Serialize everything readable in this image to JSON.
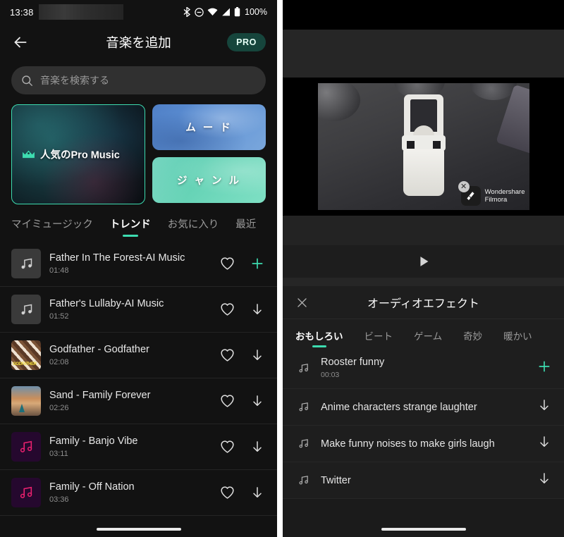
{
  "left": {
    "statusbar": {
      "time": "13:38",
      "battery_pct": "100%",
      "icons": [
        "bluetooth-icon",
        "do-not-disturb-icon",
        "wifi-icon",
        "cellular-signal-icon",
        "battery-icon"
      ]
    },
    "header": {
      "title": "音楽を追加",
      "pro_label": "PRO",
      "back_icon": "back-arrow-icon"
    },
    "search": {
      "placeholder": "音楽を検索する",
      "icon": "search-icon"
    },
    "cards": {
      "featured": {
        "label": "人気のPro Music",
        "icon": "crown-icon",
        "accent": "#3ddcb0"
      },
      "mood": {
        "label": "ム ー ド",
        "accent": "#5d90d4"
      },
      "genre": {
        "label": "ジ ャ ン ル",
        "accent": "#66d3b6"
      }
    },
    "tabs": [
      {
        "label": "マイミュージック",
        "active": false
      },
      {
        "label": "トレンド",
        "active": true
      },
      {
        "label": "お気に入り",
        "active": false
      },
      {
        "label": "最近",
        "active": false
      }
    ],
    "songs": [
      {
        "title": "Father In The Forest-AI Music",
        "duration": "01:48",
        "thumb": "note-gray",
        "action": "add",
        "fav_icon": "heart-icon"
      },
      {
        "title": "Father's Lullaby-AI Music",
        "duration": "01:52",
        "thumb": "note-gray",
        "action": "download",
        "fav_icon": "heart-icon"
      },
      {
        "title": "Godfather - Godfather",
        "duration": "02:08",
        "thumb": "stripes",
        "action": "download",
        "fav_icon": "heart-icon"
      },
      {
        "title": "Sand - Family Forever",
        "duration": "02:26",
        "thumb": "sand",
        "action": "download",
        "fav_icon": "heart-icon"
      },
      {
        "title": "Family - Banjo Vibe",
        "duration": "03:11",
        "thumb": "purple-note",
        "action": "download",
        "fav_icon": "heart-icon"
      },
      {
        "title": "Family - Off Nation",
        "duration": "03:36",
        "thumb": "purple-note",
        "action": "download",
        "fav_icon": "heart-icon"
      }
    ]
  },
  "right": {
    "watermark": {
      "brand": "Wondershare",
      "product": "Filmora",
      "close_icon": "close-icon"
    },
    "play_icon": "play-icon",
    "sheet": {
      "title": "オーディオエフェクト",
      "close_icon": "close-icon",
      "tabs": [
        {
          "label": "おもしろい",
          "active": true
        },
        {
          "label": "ビート",
          "active": false
        },
        {
          "label": "ゲーム",
          "active": false
        },
        {
          "label": "奇妙",
          "active": false
        },
        {
          "label": "暖かい",
          "active": false
        }
      ],
      "effects": [
        {
          "title": "Rooster funny",
          "duration": "00:03",
          "action": "add"
        },
        {
          "title": "Anime characters strange laughter",
          "duration": "",
          "action": "download"
        },
        {
          "title": "Make funny noises to make girls laugh",
          "duration": "",
          "action": "download"
        },
        {
          "title": "Twitter",
          "duration": "",
          "action": "download"
        }
      ]
    }
  },
  "theme": {
    "accent": "#3ddcb0",
    "bg": "#121212",
    "panel_bg": "#1e1e1e"
  }
}
